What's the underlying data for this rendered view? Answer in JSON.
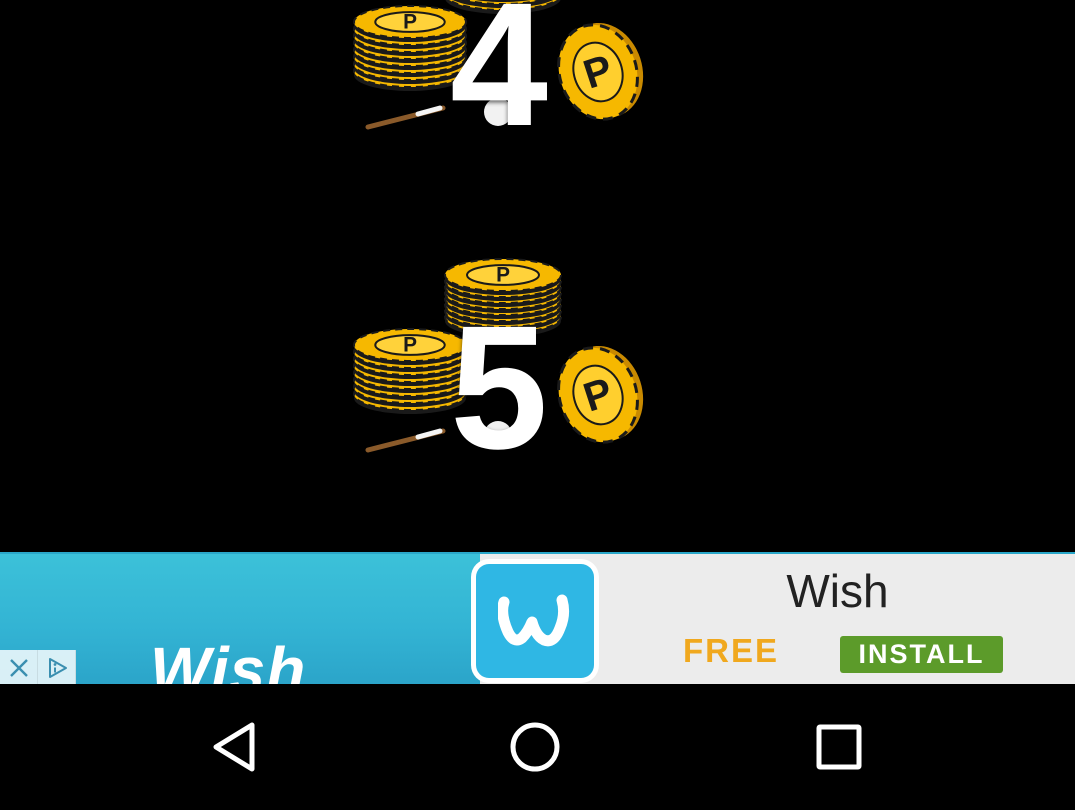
{
  "content": {
    "tiers": [
      {
        "number": "4",
        "icon": "coin-stack-icon"
      },
      {
        "number": "5",
        "icon": "coin-stack-icon"
      }
    ],
    "coin_letter": "P"
  },
  "ad": {
    "image_wordmark": "Wish",
    "app_name": "Wish",
    "price": "FREE",
    "install_label": "INSTALL",
    "app_icon": "wish-app-icon",
    "close_icon": "close-icon",
    "adchoices_icon": "adchoices-icon",
    "colors": {
      "image_bg": "#33b4d4",
      "icon_bg": "#2fb7e4",
      "price": "#f0a81e",
      "install_bg": "#5c9b2a",
      "banner_bg": "#ececec"
    }
  },
  "nav": {
    "back_icon": "back-triangle-icon",
    "home_icon": "home-circle-icon",
    "recents_icon": "recents-square-icon"
  },
  "colors": {
    "background": "#000000",
    "coin_gold": "#f6b800",
    "coin_dark": "#1a1a1a"
  }
}
